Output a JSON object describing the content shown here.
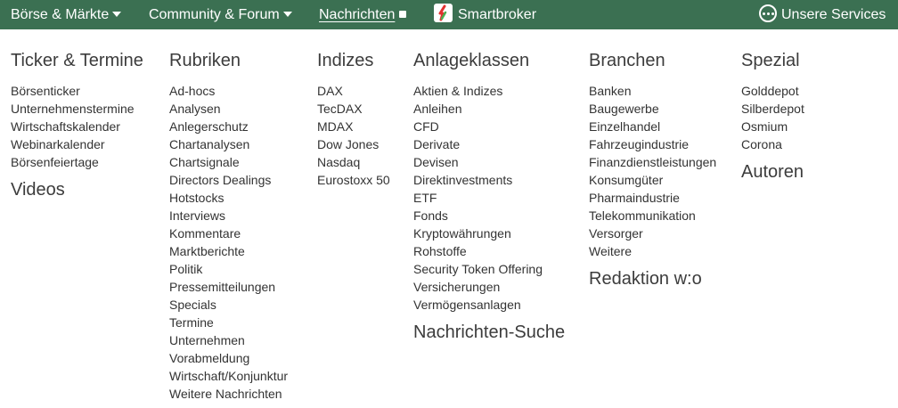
{
  "nav": {
    "boerse_maerkte": "Börse & Märkte",
    "community_forum": "Community & Forum",
    "nachrichten": "Nachrichten",
    "smartbroker": "Smartbroker",
    "unsere_services": "Unsere Services"
  },
  "colors": {
    "topbar_bg": "#3b7052",
    "smartbroker_logo_red": "#e2312f",
    "smartbroker_logo_green": "#4caf50"
  },
  "icons": [
    "caret-down-icon",
    "square-icon",
    "smartbroker-logo-icon",
    "more-dots-circle-icon"
  ],
  "columns": {
    "ticker": {
      "title": "Ticker & Termine",
      "items": [
        "Börsenticker",
        "Unternehmenstermine",
        "Wirtschaftskalender",
        "Webinarkalender",
        "Börsenfeiertage"
      ],
      "title2": "Videos"
    },
    "rubriken": {
      "title": "Rubriken",
      "items": [
        "Ad-hocs",
        "Analysen",
        "Anlegerschutz",
        "Chartanalysen",
        "Chartsignale",
        "Directors Dealings",
        "Hotstocks",
        "Interviews",
        "Kommentare",
        "Marktberichte",
        "Politik",
        "Pressemitteilungen",
        "Specials",
        "Termine",
        "Unternehmen",
        "Vorabmeldung",
        "Wirtschaft/Konjunktur",
        "Weitere Nachrichten"
      ]
    },
    "indizes": {
      "title": "Indizes",
      "items": [
        "DAX",
        "TecDAX",
        "MDAX",
        "Dow Jones",
        "Nasdaq",
        "Eurostoxx 50"
      ]
    },
    "anlageklassen": {
      "title": "Anlageklassen",
      "items": [
        "Aktien & Indizes",
        "Anleihen",
        "CFD",
        "Derivate",
        "Devisen",
        "Direktinvestments",
        "ETF",
        "Fonds",
        "Kryptowährungen",
        "Rohstoffe",
        "Security Token Offering",
        "Versicherungen",
        "Vermögensanlagen"
      ],
      "title2": "Nachrichten-Suche"
    },
    "branchen": {
      "title": "Branchen",
      "items": [
        "Banken",
        "Baugewerbe",
        "Einzelhandel",
        "Fahrzeugindustrie",
        "Finanzdienstleistungen",
        "Konsumgüter",
        "Pharmaindustrie",
        "Telekommunikation",
        "Versorger",
        "Weitere"
      ],
      "title2": "Redaktion w:o"
    },
    "spezial": {
      "title": "Spezial",
      "items": [
        "Golddepot",
        "Silberdepot",
        "Osmium",
        "Corona"
      ],
      "title2": "Autoren"
    }
  }
}
